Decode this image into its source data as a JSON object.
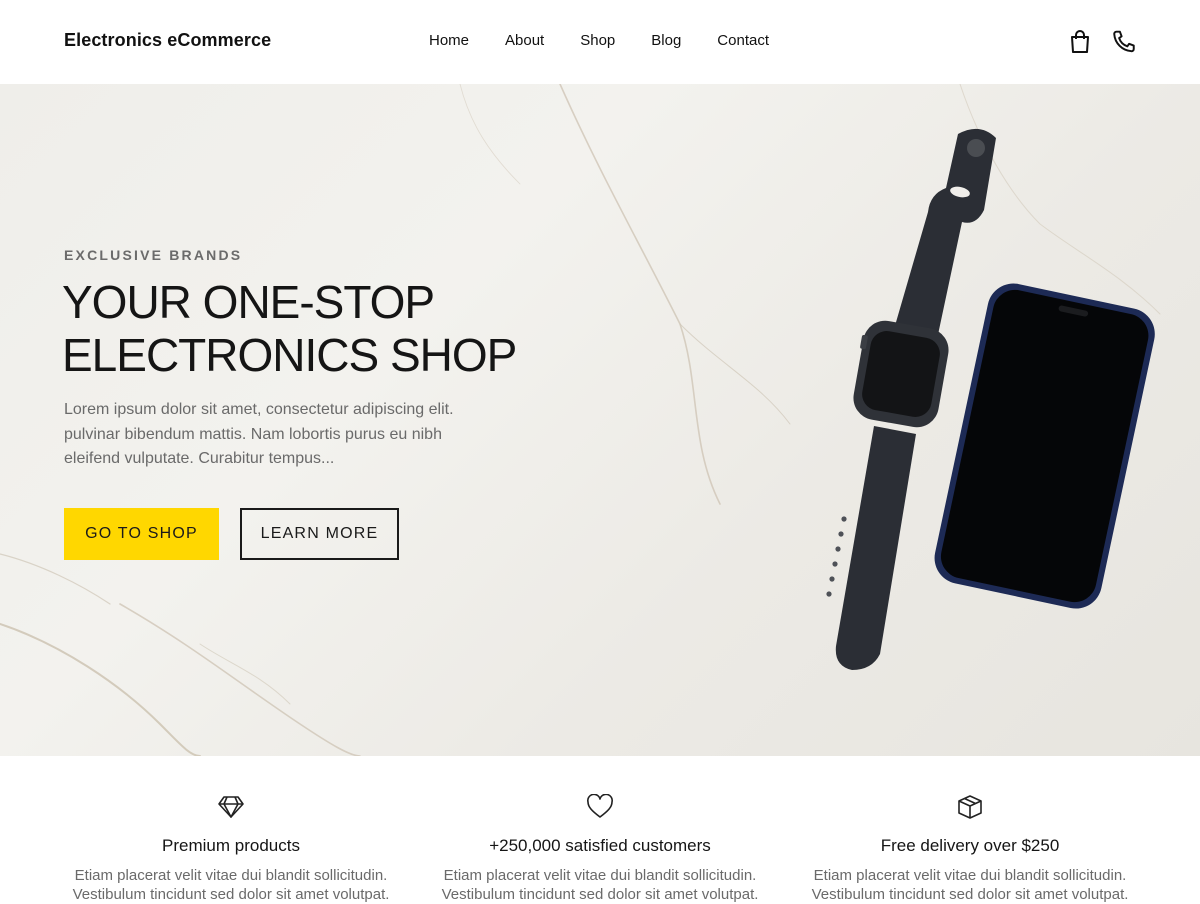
{
  "header": {
    "brand": "Electronics eCommerce",
    "nav": [
      "Home",
      "About",
      "Shop",
      "Blog",
      "Contact"
    ],
    "icons": [
      "shopping-bag-icon",
      "phone-icon"
    ]
  },
  "hero": {
    "eyebrow": "EXCLUSIVE BRANDS",
    "headline_line1": "YOUR ONE-STOP",
    "headline_line2": "ELECTRONICS SHOP",
    "description": "Lorem ipsum dolor sit amet, consectetur adipiscing elit. pulvinar bibendum mattis. Nam lobortis purus eu nibh eleifend vulputate. Curabitur tempus...",
    "primary_button": "GO TO SHOP",
    "secondary_button": "LEARN MORE",
    "accent_color": "#ffd700"
  },
  "features": [
    {
      "icon": "diamond-icon",
      "title": "Premium products",
      "text": "Etiam placerat velit vitae dui blandit sollicitudin. Vestibulum tincidunt sed dolor sit amet volutpat."
    },
    {
      "icon": "heart-icon",
      "title": "+250,000 satisfied customers",
      "text": "Etiam placerat velit vitae dui blandit sollicitudin. Vestibulum tincidunt sed dolor sit amet volutpat."
    },
    {
      "icon": "box-icon",
      "title": "Free delivery over $250",
      "text": "Etiam placerat velit vitae dui blandit sollicitudin. Vestibulum tincidunt sed dolor sit amet volutpat."
    }
  ]
}
